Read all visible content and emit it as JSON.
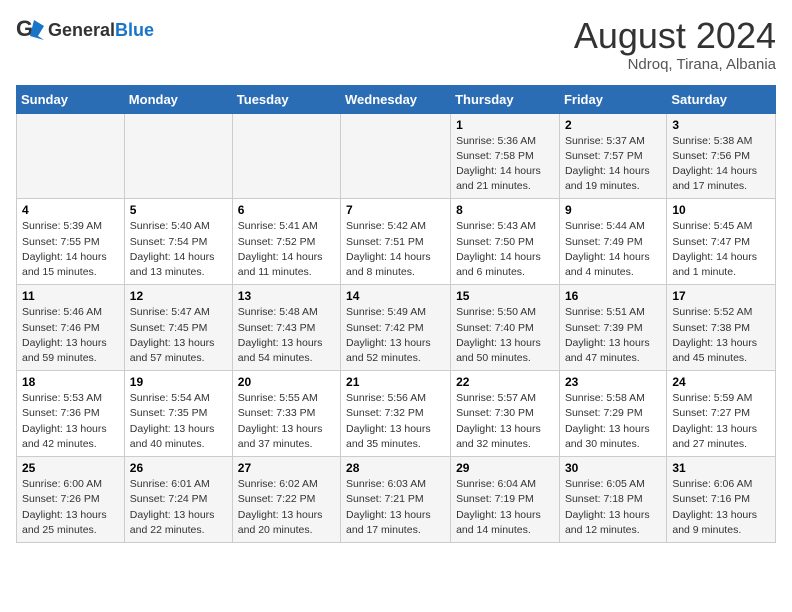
{
  "header": {
    "logo_general": "General",
    "logo_blue": "Blue",
    "month_year": "August 2024",
    "location": "Ndroq, Tirana, Albania"
  },
  "days_of_week": [
    "Sunday",
    "Monday",
    "Tuesday",
    "Wednesday",
    "Thursday",
    "Friday",
    "Saturday"
  ],
  "weeks": [
    [
      {
        "day": "",
        "info": ""
      },
      {
        "day": "",
        "info": ""
      },
      {
        "day": "",
        "info": ""
      },
      {
        "day": "",
        "info": ""
      },
      {
        "day": "1",
        "info": "Sunrise: 5:36 AM\nSunset: 7:58 PM\nDaylight: 14 hours\nand 21 minutes."
      },
      {
        "day": "2",
        "info": "Sunrise: 5:37 AM\nSunset: 7:57 PM\nDaylight: 14 hours\nand 19 minutes."
      },
      {
        "day": "3",
        "info": "Sunrise: 5:38 AM\nSunset: 7:56 PM\nDaylight: 14 hours\nand 17 minutes."
      }
    ],
    [
      {
        "day": "4",
        "info": "Sunrise: 5:39 AM\nSunset: 7:55 PM\nDaylight: 14 hours\nand 15 minutes."
      },
      {
        "day": "5",
        "info": "Sunrise: 5:40 AM\nSunset: 7:54 PM\nDaylight: 14 hours\nand 13 minutes."
      },
      {
        "day": "6",
        "info": "Sunrise: 5:41 AM\nSunset: 7:52 PM\nDaylight: 14 hours\nand 11 minutes."
      },
      {
        "day": "7",
        "info": "Sunrise: 5:42 AM\nSunset: 7:51 PM\nDaylight: 14 hours\nand 8 minutes."
      },
      {
        "day": "8",
        "info": "Sunrise: 5:43 AM\nSunset: 7:50 PM\nDaylight: 14 hours\nand 6 minutes."
      },
      {
        "day": "9",
        "info": "Sunrise: 5:44 AM\nSunset: 7:49 PM\nDaylight: 14 hours\nand 4 minutes."
      },
      {
        "day": "10",
        "info": "Sunrise: 5:45 AM\nSunset: 7:47 PM\nDaylight: 14 hours\nand 1 minute."
      }
    ],
    [
      {
        "day": "11",
        "info": "Sunrise: 5:46 AM\nSunset: 7:46 PM\nDaylight: 13 hours\nand 59 minutes."
      },
      {
        "day": "12",
        "info": "Sunrise: 5:47 AM\nSunset: 7:45 PM\nDaylight: 13 hours\nand 57 minutes."
      },
      {
        "day": "13",
        "info": "Sunrise: 5:48 AM\nSunset: 7:43 PM\nDaylight: 13 hours\nand 54 minutes."
      },
      {
        "day": "14",
        "info": "Sunrise: 5:49 AM\nSunset: 7:42 PM\nDaylight: 13 hours\nand 52 minutes."
      },
      {
        "day": "15",
        "info": "Sunrise: 5:50 AM\nSunset: 7:40 PM\nDaylight: 13 hours\nand 50 minutes."
      },
      {
        "day": "16",
        "info": "Sunrise: 5:51 AM\nSunset: 7:39 PM\nDaylight: 13 hours\nand 47 minutes."
      },
      {
        "day": "17",
        "info": "Sunrise: 5:52 AM\nSunset: 7:38 PM\nDaylight: 13 hours\nand 45 minutes."
      }
    ],
    [
      {
        "day": "18",
        "info": "Sunrise: 5:53 AM\nSunset: 7:36 PM\nDaylight: 13 hours\nand 42 minutes."
      },
      {
        "day": "19",
        "info": "Sunrise: 5:54 AM\nSunset: 7:35 PM\nDaylight: 13 hours\nand 40 minutes."
      },
      {
        "day": "20",
        "info": "Sunrise: 5:55 AM\nSunset: 7:33 PM\nDaylight: 13 hours\nand 37 minutes."
      },
      {
        "day": "21",
        "info": "Sunrise: 5:56 AM\nSunset: 7:32 PM\nDaylight: 13 hours\nand 35 minutes."
      },
      {
        "day": "22",
        "info": "Sunrise: 5:57 AM\nSunset: 7:30 PM\nDaylight: 13 hours\nand 32 minutes."
      },
      {
        "day": "23",
        "info": "Sunrise: 5:58 AM\nSunset: 7:29 PM\nDaylight: 13 hours\nand 30 minutes."
      },
      {
        "day": "24",
        "info": "Sunrise: 5:59 AM\nSunset: 7:27 PM\nDaylight: 13 hours\nand 27 minutes."
      }
    ],
    [
      {
        "day": "25",
        "info": "Sunrise: 6:00 AM\nSunset: 7:26 PM\nDaylight: 13 hours\nand 25 minutes."
      },
      {
        "day": "26",
        "info": "Sunrise: 6:01 AM\nSunset: 7:24 PM\nDaylight: 13 hours\nand 22 minutes."
      },
      {
        "day": "27",
        "info": "Sunrise: 6:02 AM\nSunset: 7:22 PM\nDaylight: 13 hours\nand 20 minutes."
      },
      {
        "day": "28",
        "info": "Sunrise: 6:03 AM\nSunset: 7:21 PM\nDaylight: 13 hours\nand 17 minutes."
      },
      {
        "day": "29",
        "info": "Sunrise: 6:04 AM\nSunset: 7:19 PM\nDaylight: 13 hours\nand 14 minutes."
      },
      {
        "day": "30",
        "info": "Sunrise: 6:05 AM\nSunset: 7:18 PM\nDaylight: 13 hours\nand 12 minutes."
      },
      {
        "day": "31",
        "info": "Sunrise: 6:06 AM\nSunset: 7:16 PM\nDaylight: 13 hours\nand 9 minutes."
      }
    ]
  ]
}
